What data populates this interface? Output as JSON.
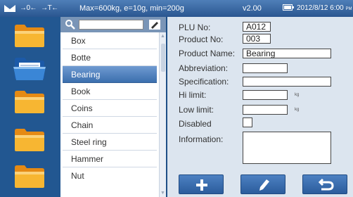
{
  "status": {
    "zero_indicator": "→0←",
    "tare_indicator": "→T←",
    "capacity": "Max=600kg, e=10g, min=200g",
    "version": "v2.00",
    "datetime": "2012/8/12 6:00",
    "ampm": "PM",
    "icons": [
      "stable-wedge-icon",
      "battery-icon"
    ]
  },
  "folders": {
    "icons": [
      "folder-icon",
      "folder-open-icon",
      "folder-icon",
      "folder-icon",
      "folder-icon"
    ]
  },
  "search": {
    "value": "",
    "placeholder": ""
  },
  "list": {
    "items": [
      "Box",
      "Botte",
      "Bearing",
      "Book",
      "Coins",
      "Chain",
      "Steel ring",
      "Hammer",
      "Nut"
    ],
    "selected": "Bearing"
  },
  "detail": {
    "plu_label": "PLU No:",
    "plu_value": "A012",
    "product_no_label": "Product No:",
    "product_no_value": "003",
    "product_name_label": "Product Name:",
    "product_name_value": "Bearing",
    "abbreviation_label": "Abbreviation:",
    "abbreviation_value": "",
    "specification_label": "Specification:",
    "specification_value": "",
    "hi_limit_label": "Hi limit:",
    "hi_limit_value": "",
    "hi_limit_unit": "kg",
    "low_limit_label": "Low limit:",
    "low_limit_value": "",
    "low_limit_unit": "kg",
    "disabled_label": "Disabled",
    "disabled_checked": false,
    "information_label": "Information:",
    "information_value": ""
  },
  "buttons": [
    "add-icon",
    "edit-icon",
    "back-icon"
  ],
  "colors": {
    "background": "#1e4f86",
    "selection": "#4a7cbc",
    "panel": "#dce5ef",
    "button": "#3a6cae"
  }
}
